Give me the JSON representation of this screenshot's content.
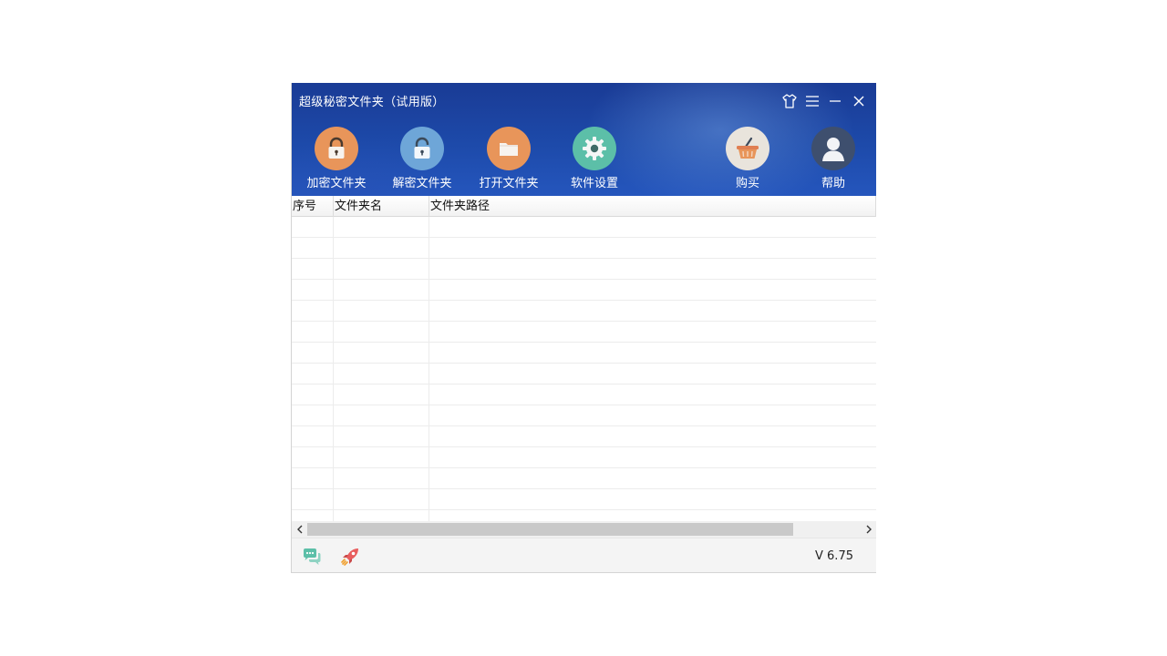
{
  "window": {
    "title": "超级秘密文件夹（试用版）"
  },
  "title_bar": {
    "controls": [
      {
        "name": "skin-icon"
      },
      {
        "name": "menu-icon"
      },
      {
        "name": "minimize-icon"
      },
      {
        "name": "close-icon"
      }
    ]
  },
  "toolbar": {
    "encrypt": {
      "label": "加密文件夹",
      "icon": "locked-padlock-icon",
      "color": "#e8955a"
    },
    "decrypt": {
      "label": "解密文件夹",
      "icon": "unlocked-padlock-icon",
      "color": "#6ea6d8"
    },
    "open": {
      "label": "打开文件夹",
      "icon": "folder-icon",
      "color": "#e8955a"
    },
    "settings": {
      "label": "软件设置",
      "icon": "gear-icon",
      "color": "#5cbfa8"
    },
    "buy": {
      "label": "购买",
      "icon": "basket-icon",
      "color": "#e9e4dc"
    },
    "help": {
      "label": "帮助",
      "icon": "user-avatar-icon",
      "color": "#3e4f6e"
    }
  },
  "table": {
    "columns": [
      "序号",
      "文件夹名",
      "文件夹路径"
    ],
    "rows": []
  },
  "footer": {
    "feedback_icon": "chat-bubbles-icon",
    "boost_icon": "rocket-icon",
    "version": "V 6.75"
  },
  "colors": {
    "header_blue": "#1d4aaa",
    "orange": "#e8955a",
    "teal": "#5cbfa8"
  }
}
